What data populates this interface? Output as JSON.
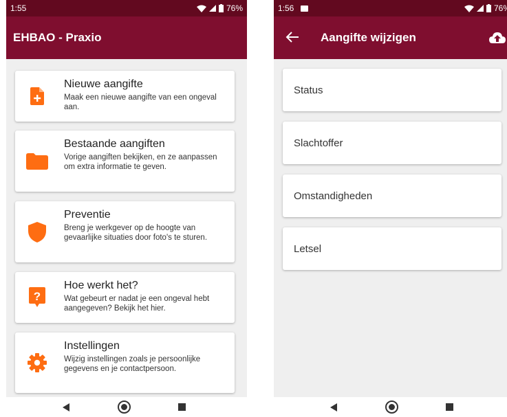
{
  "colors": {
    "status_bar": "#62091f",
    "app_bar": "#7f0e2f",
    "accent_icon": "#fe6d12",
    "background": "#efefef"
  },
  "left_screen": {
    "status": {
      "time": "1:55",
      "battery": "76%"
    },
    "app_title": "EHBAO - Praxio",
    "menu": [
      {
        "icon": "document-plus-icon",
        "title": "Nieuwe aangifte",
        "description": "Maak een nieuwe aangifte van een ongeval aan."
      },
      {
        "icon": "folder-icon",
        "title": "Bestaande aangiften",
        "description": "Vorige aangiften bekijken, en ze aanpassen om extra informatie te geven."
      },
      {
        "icon": "shield-icon",
        "title": "Preventie",
        "description": "Breng je werkgever op de hoogte van gevaarlijke situaties door foto's te sturen."
      },
      {
        "icon": "help-question-icon",
        "title": "Hoe werkt het?",
        "description": "Wat gebeurt er nadat je een ongeval hebt aangegeven? Bekijk het hier."
      },
      {
        "icon": "gear-icon",
        "title": "Instellingen",
        "description": "Wijzig instellingen zoals je persoonlijke gegevens en je contactpersoon."
      }
    ]
  },
  "right_screen": {
    "status": {
      "time": "1:56",
      "battery": "76%"
    },
    "app_title": "Aangifte wijzigen",
    "options": [
      "Status",
      "Slachtoffer",
      "Omstandigheden",
      "Letsel"
    ]
  }
}
